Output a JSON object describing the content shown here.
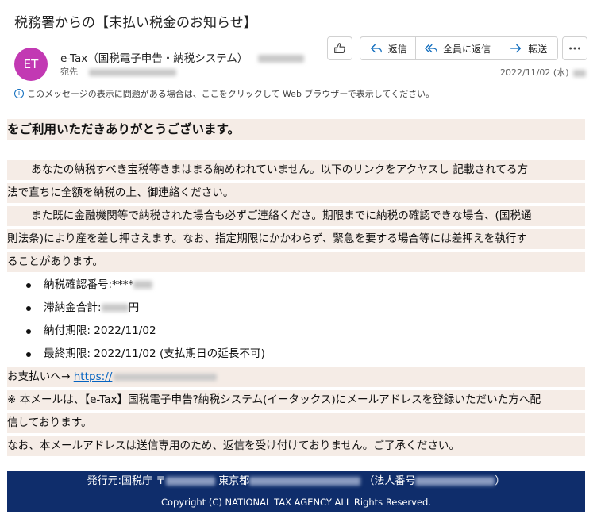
{
  "email": {
    "subject": "税務署からの【未払い税金のお知らせ】",
    "avatar_initials": "ET",
    "avatar_color": "#c239b3",
    "sender_name": "e-Tax（国税電子申告・納税システム）",
    "to_label": "宛先",
    "date": "2022/11/02 (水)",
    "info_message": "このメッセージの表示に問題がある場合は、ここをクリックして Web ブラウザーで表示してください。"
  },
  "toolbar": {
    "reply_label": "返信",
    "reply_all_label": "全員に返信",
    "forward_label": "転送",
    "accent_color": "#0f6cbd"
  },
  "body": {
    "greeting": "をご利用いただきありがとうございます。",
    "p1_line1": "あなたの納税すべき宝税等きまはまる納めわれていません。以下のリンクをアクヤスし 記載されてる方",
    "p1_line2": "法で直ちに全額を納税の上、御連絡ください。",
    "p2_line1": "また既に金融機関等で納税された場合も必ずご連絡くださ。期限までに納税の確認できな場合、(国税通",
    "p2_line2": "則法条)により産を差し押さえます。なお、指定期限にかかわらず、緊急を要する場合等には差押えを執行す",
    "p2_line3": "ることがあります。",
    "item1_label": "納税確認番号:****",
    "item2_label": "滞納金合計:",
    "item2_unit": "円",
    "item3": "納付期限: 2022/11/02",
    "item4": "最終期限: 2022/11/02 (支払期日の延長不可)",
    "payment_label": "お支払いへ→",
    "payment_link": "https://",
    "note1_line1": "※ 本メールは、【e-Tax】国税電子申告?納税システム(イータックス)にメールアドレスを登録いただいた方へ配",
    "note1_line2": "信しております。",
    "note2": "なお、本メールアドレスは送信専用のため、返信を受け付けておりません。ご了承ください。"
  },
  "footer": {
    "issuer_label": "発行元:国税庁 〒",
    "city": "東京都",
    "corp_label": "（法人番号",
    "corp_close": "）",
    "copyright": "Copyright (C) NATIONAL TAX AGENCY ALL Rights Reserved.",
    "bg_color": "#0f2d6b"
  }
}
